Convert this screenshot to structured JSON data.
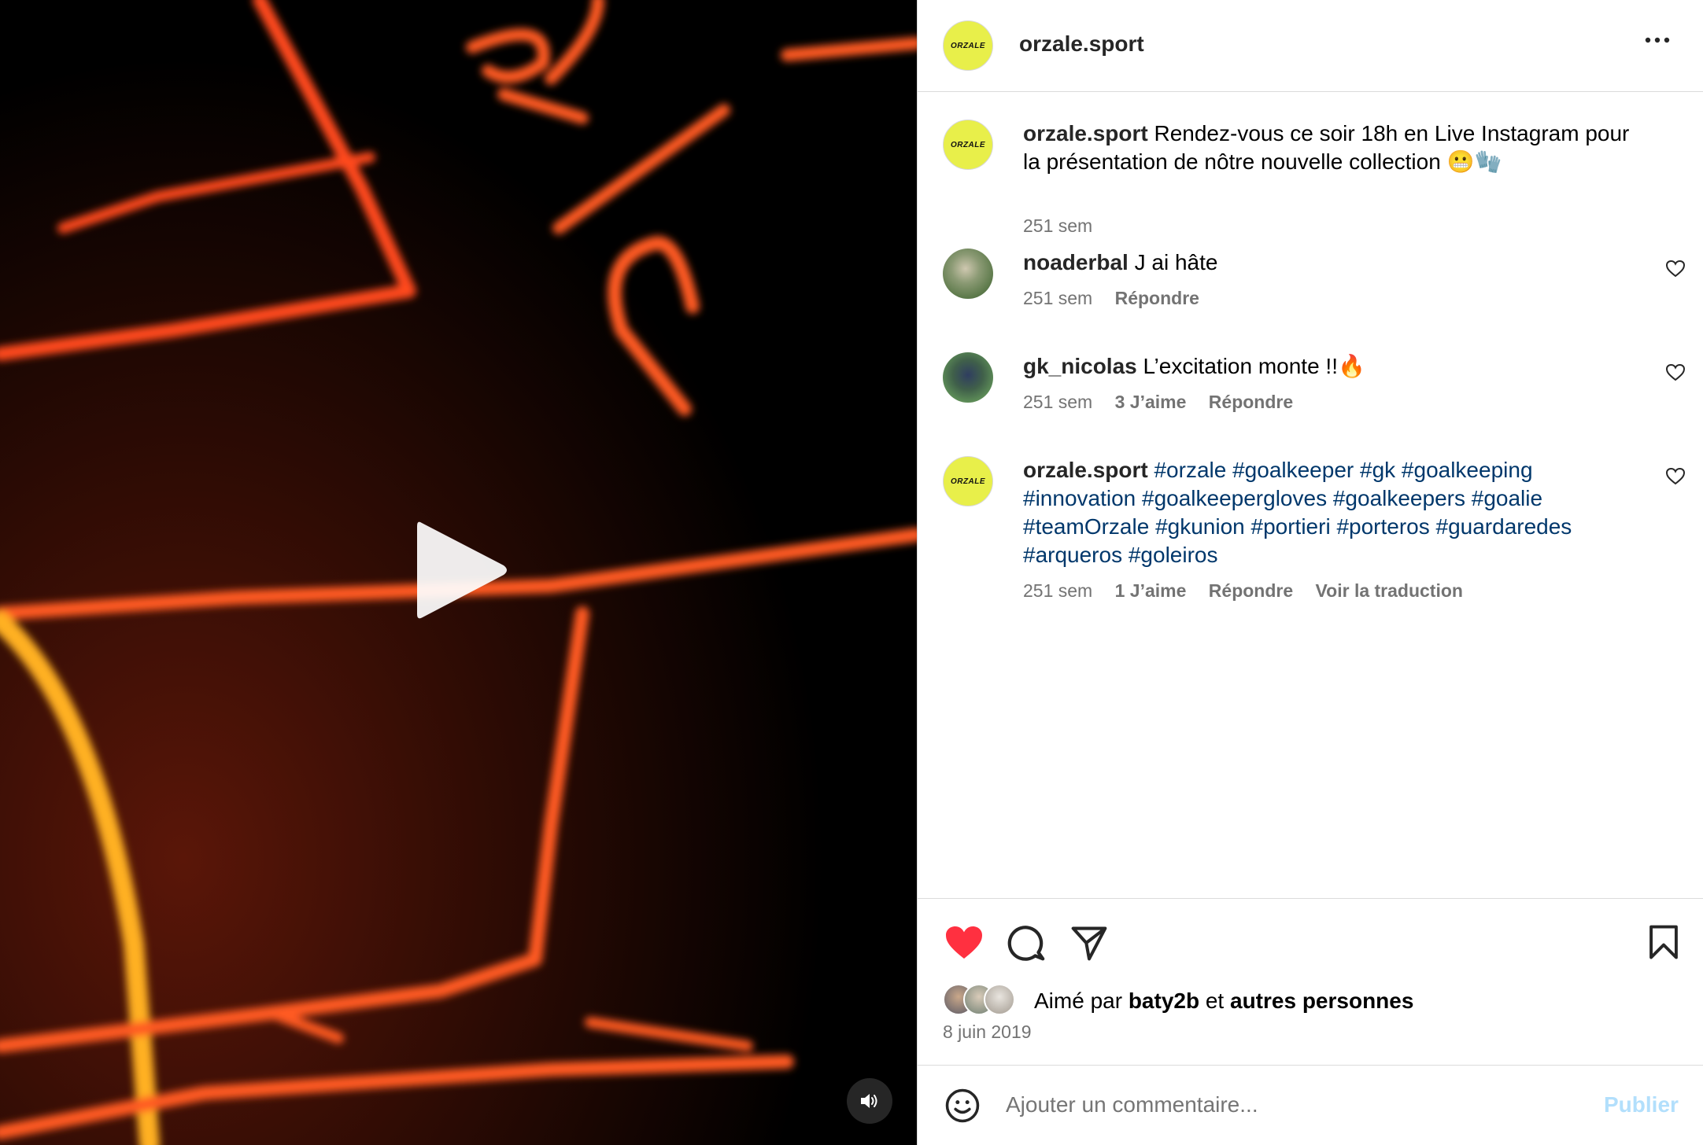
{
  "post": {
    "username": "orzale.sport",
    "avatar_text": "ORZALE",
    "more_icon": "more-horizontal-icon"
  },
  "caption": {
    "username": "orzale.sport",
    "text": "Rendez-vous ce soir 18h en Live Instagram pour la présentation de nôtre nouvelle collection 😬🧤",
    "time": "251 sem"
  },
  "comments": [
    {
      "username": "noaderbal",
      "text": "J ai hâte",
      "time": "251 sem",
      "likes": "",
      "reply": "Répondre"
    },
    {
      "username": "gk_nicolas",
      "text": "L’excitation monte !!🔥",
      "time": "251 sem",
      "likes": "3 J’aime",
      "reply": "Répondre"
    },
    {
      "username": "orzale.sport",
      "tags_line1": "#orzale #goalkeeper #gk #goalkeeping",
      "tags_line2": "#innovation #goalkeepergloves #goalkeepers #goalie",
      "tags_line3": "#teamOrzale #gkunion #portieri #porteros #guardaredes",
      "tags_line4": "#arqueros #goleiros",
      "time": "251 sem",
      "likes": "1 J’aime",
      "reply": "Répondre",
      "translate": "Voir la traduction"
    }
  ],
  "likes_bar": {
    "prefix": "Aimé par",
    "user": "baty2b",
    "middle": "et",
    "others": "autres personnes"
  },
  "date": "8 juin 2019",
  "add_comment": {
    "placeholder": "Ajouter un commentaire...",
    "publish": "Publier"
  },
  "colors": {
    "like_red": "#ff3040",
    "hashtag": "#00376b",
    "publish_disabled": "#b2dffc",
    "logo_yellow": "#e8ef4a"
  }
}
